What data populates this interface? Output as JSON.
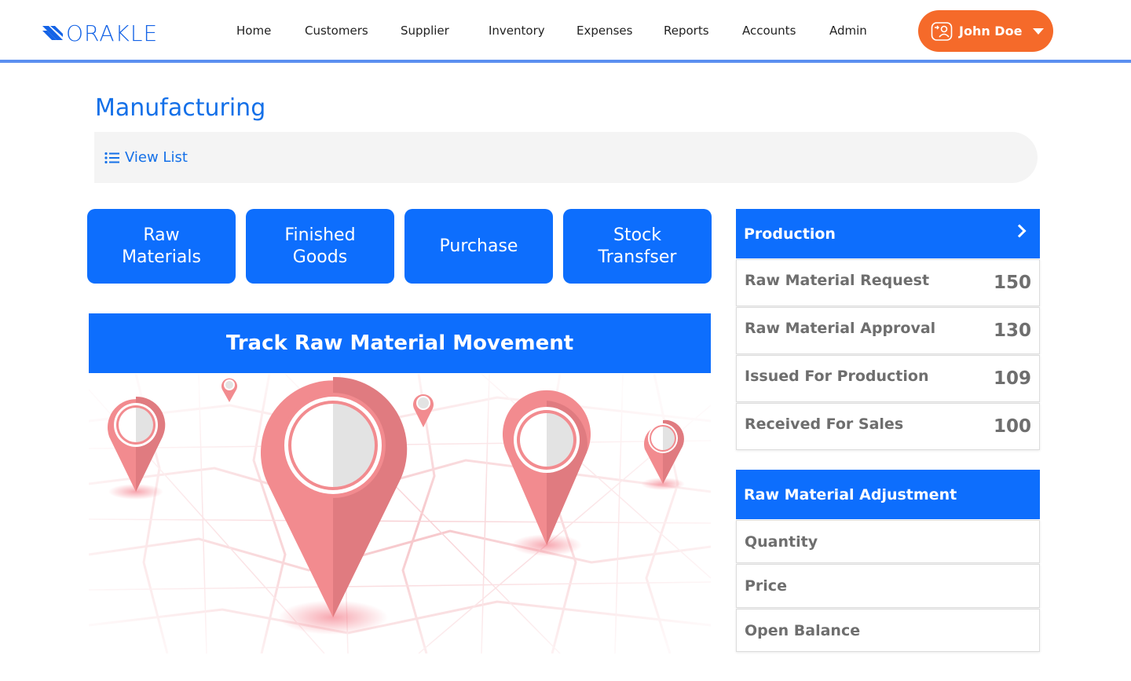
{
  "brand": {
    "logo_text": "ORAKLE",
    "color": "#1463e6"
  },
  "nav": {
    "items": [
      {
        "label": "Home"
      },
      {
        "label": "Customers"
      },
      {
        "label": "Supplier"
      },
      {
        "label": "Inventory"
      },
      {
        "label": "Expenses"
      },
      {
        "label": "Reports"
      },
      {
        "label": "Accounts"
      },
      {
        "label": "Admin"
      }
    ]
  },
  "user": {
    "name": "John Doe",
    "icon": "user-switch-icon",
    "accent": "#f56a2a"
  },
  "page": {
    "title": "Manufacturing",
    "view_list_label": "View List",
    "view_list_icon": "list-icon"
  },
  "tiles": [
    {
      "label": "Raw Materials"
    },
    {
      "label": "Finished Goods"
    },
    {
      "label": "Purchase"
    },
    {
      "label": "Stock Transfser"
    }
  ],
  "track": {
    "label": "Track Raw Material Movement",
    "image": "map-pins-illustration"
  },
  "production": {
    "title": "Production",
    "rows": [
      {
        "label": "Raw Material Request",
        "value": "150"
      },
      {
        "label": "Raw Material Approval",
        "value": "130"
      },
      {
        "label": "Issued For Production",
        "value": "109"
      },
      {
        "label": "Received For Sales",
        "value": "100"
      }
    ]
  },
  "adjustment": {
    "title": "Raw Material Adjustment",
    "rows": [
      {
        "label": "Quantity"
      },
      {
        "label": "Price"
      },
      {
        "label": "Open Balance"
      }
    ]
  },
  "colors": {
    "primary": "#0d6efd",
    "title": "#1470e8",
    "divider": "#5b8ff0"
  }
}
